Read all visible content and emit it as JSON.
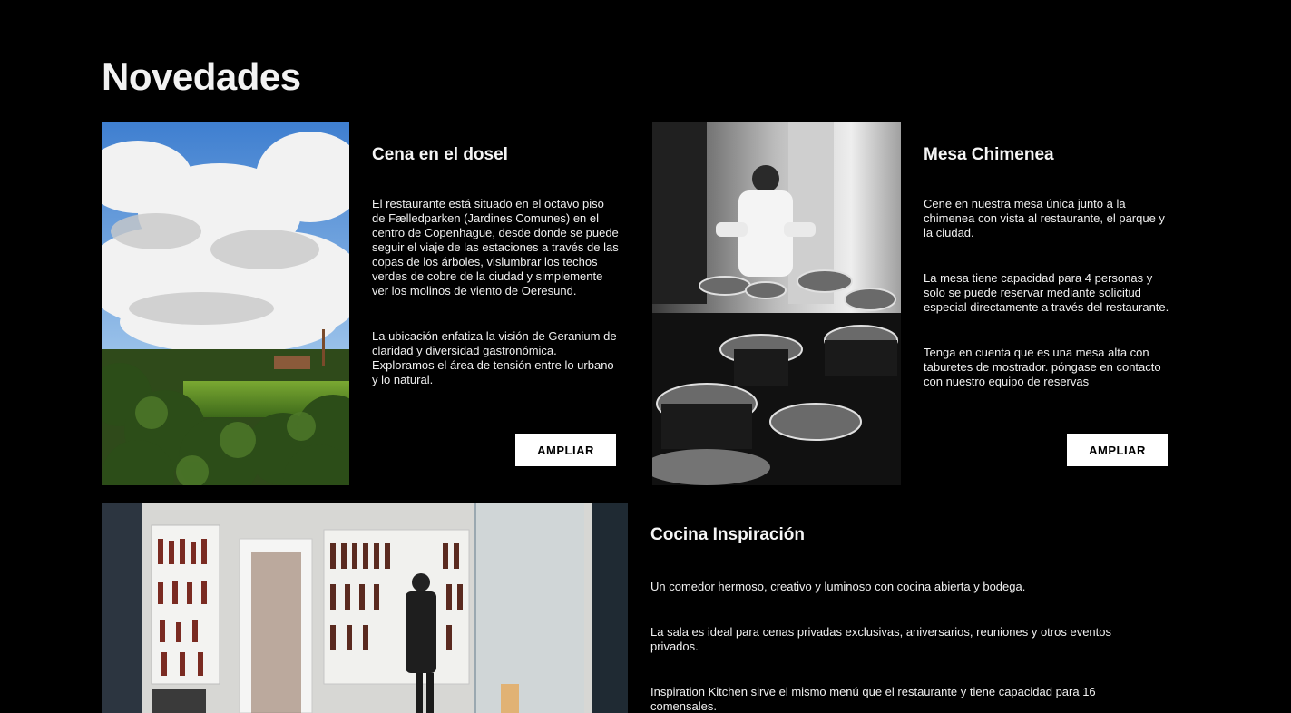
{
  "section": {
    "title": "Novedades"
  },
  "cards": [
    {
      "title": "Cena en el dosel",
      "paragraphs": [
        "El restaurante está situado en el octavo piso de Fælledparken (Jardines Comunes) en el centro de Copenhague, desde donde se puede seguir el viaje de las estaciones a través de las copas de los árboles, vislumbrar los techos verdes de cobre de la ciudad y simplemente ver los molinos de viento de Oeresund.",
        "La ubicación enfatiza la visión de Geranium de claridad y diversidad gastronómica. Exploramos el área de tensión entre lo urbano y lo natural."
      ],
      "button": "AMPLIAR"
    },
    {
      "title": "Mesa Chimenea",
      "paragraphs": [
        "Cene en nuestra mesa única junto a la chimenea con vista al restaurante, el parque y la ciudad.",
        "La mesa tiene capacidad para 4 personas y solo se puede reservar mediante solicitud especial directamente a través del restaurante.",
        "Tenga en cuenta que es una mesa alta con taburetes de mostrador. póngase en contacto con nuestro equipo de reservas"
      ],
      "button": "AMPLIAR"
    },
    {
      "title": "Cocina Inspiración",
      "paragraphs": [
        "Un comedor hermoso, creativo y luminoso con cocina abierta y bodega.",
        "La sala es ideal para cenas privadas exclusivas, aniversarios, reuniones y otros eventos privados.",
        "Inspiration Kitchen sirve el mismo menú que el restaurante y tiene capacidad para 16 comensales."
      ]
    }
  ]
}
